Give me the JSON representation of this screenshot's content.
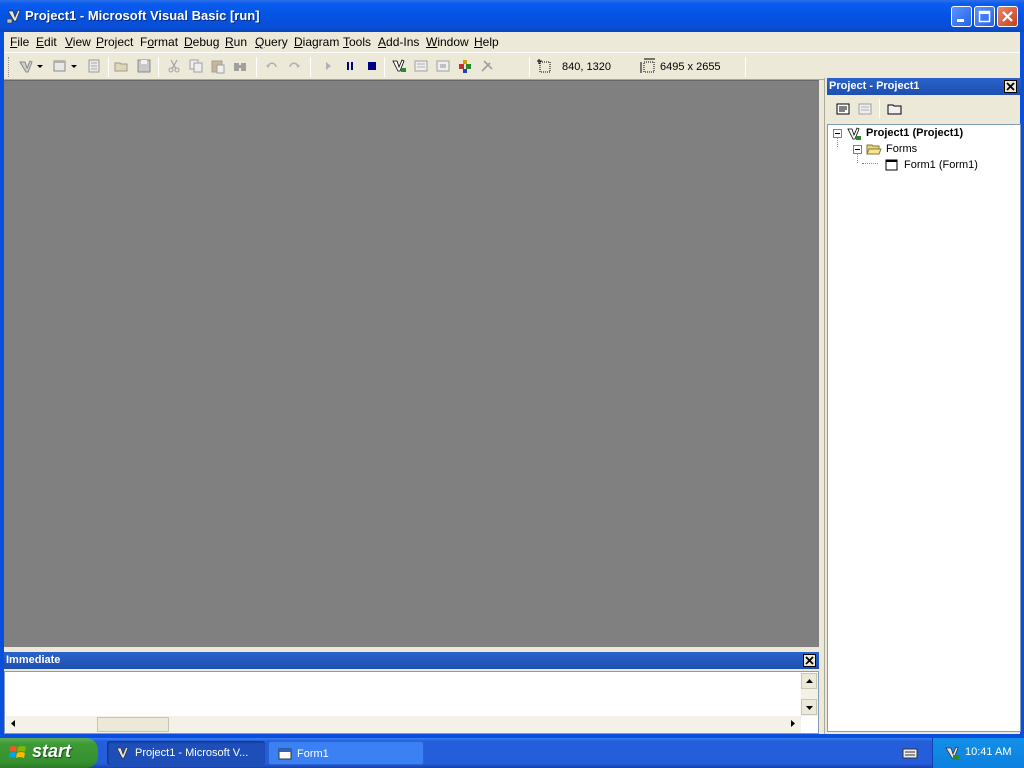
{
  "window": {
    "title": "Project1 - Microsoft Visual Basic [run]"
  },
  "menu": {
    "items": [
      {
        "label": "File",
        "accel": "F",
        "rest": "ile"
      },
      {
        "label": "Edit",
        "accel": "E",
        "rest": "dit"
      },
      {
        "label": "View",
        "accel": "V",
        "rest": "iew"
      },
      {
        "label": "Project",
        "accel": "P",
        "rest": "roject"
      },
      {
        "label": "Format",
        "accel": "o",
        "pre": "F",
        "rest": "rmat"
      },
      {
        "label": "Debug",
        "accel": "D",
        "rest": "ebug"
      },
      {
        "label": "Run",
        "accel": "R",
        "rest": "un"
      },
      {
        "label": "Query",
        "accel": "Q",
        "rest": "uery"
      },
      {
        "label": "Diagram",
        "accel": "D",
        "rest": "iagram"
      },
      {
        "label": "Tools",
        "accel": "T",
        "rest": "ools"
      },
      {
        "label": "Add-Ins",
        "accel": "A",
        "rest": "dd-Ins"
      },
      {
        "label": "Window",
        "accel": "W",
        "rest": "indow"
      },
      {
        "label": "Help",
        "accel": "H",
        "rest": "elp"
      }
    ]
  },
  "toolbar": {
    "position_readout": "840, 1320",
    "size_readout": "6495 x 2655"
  },
  "immediate": {
    "title": "Immediate"
  },
  "project_explorer": {
    "title": "Project - Project1",
    "tree": {
      "root": "Project1 (Project1)",
      "folder": "Forms",
      "item": "Form1 (Form1)"
    }
  },
  "taskbar": {
    "start_label": "start",
    "tasks": [
      {
        "label": "Project1 - Microsoft V...",
        "active": true
      },
      {
        "label": "Form1",
        "active": false
      }
    ],
    "clock": "10:41 AM"
  },
  "colors": {
    "title_blue": "#0353e3",
    "mdi_gray": "#808080",
    "face": "#ece9d8",
    "start_green": "#3c9a34"
  }
}
